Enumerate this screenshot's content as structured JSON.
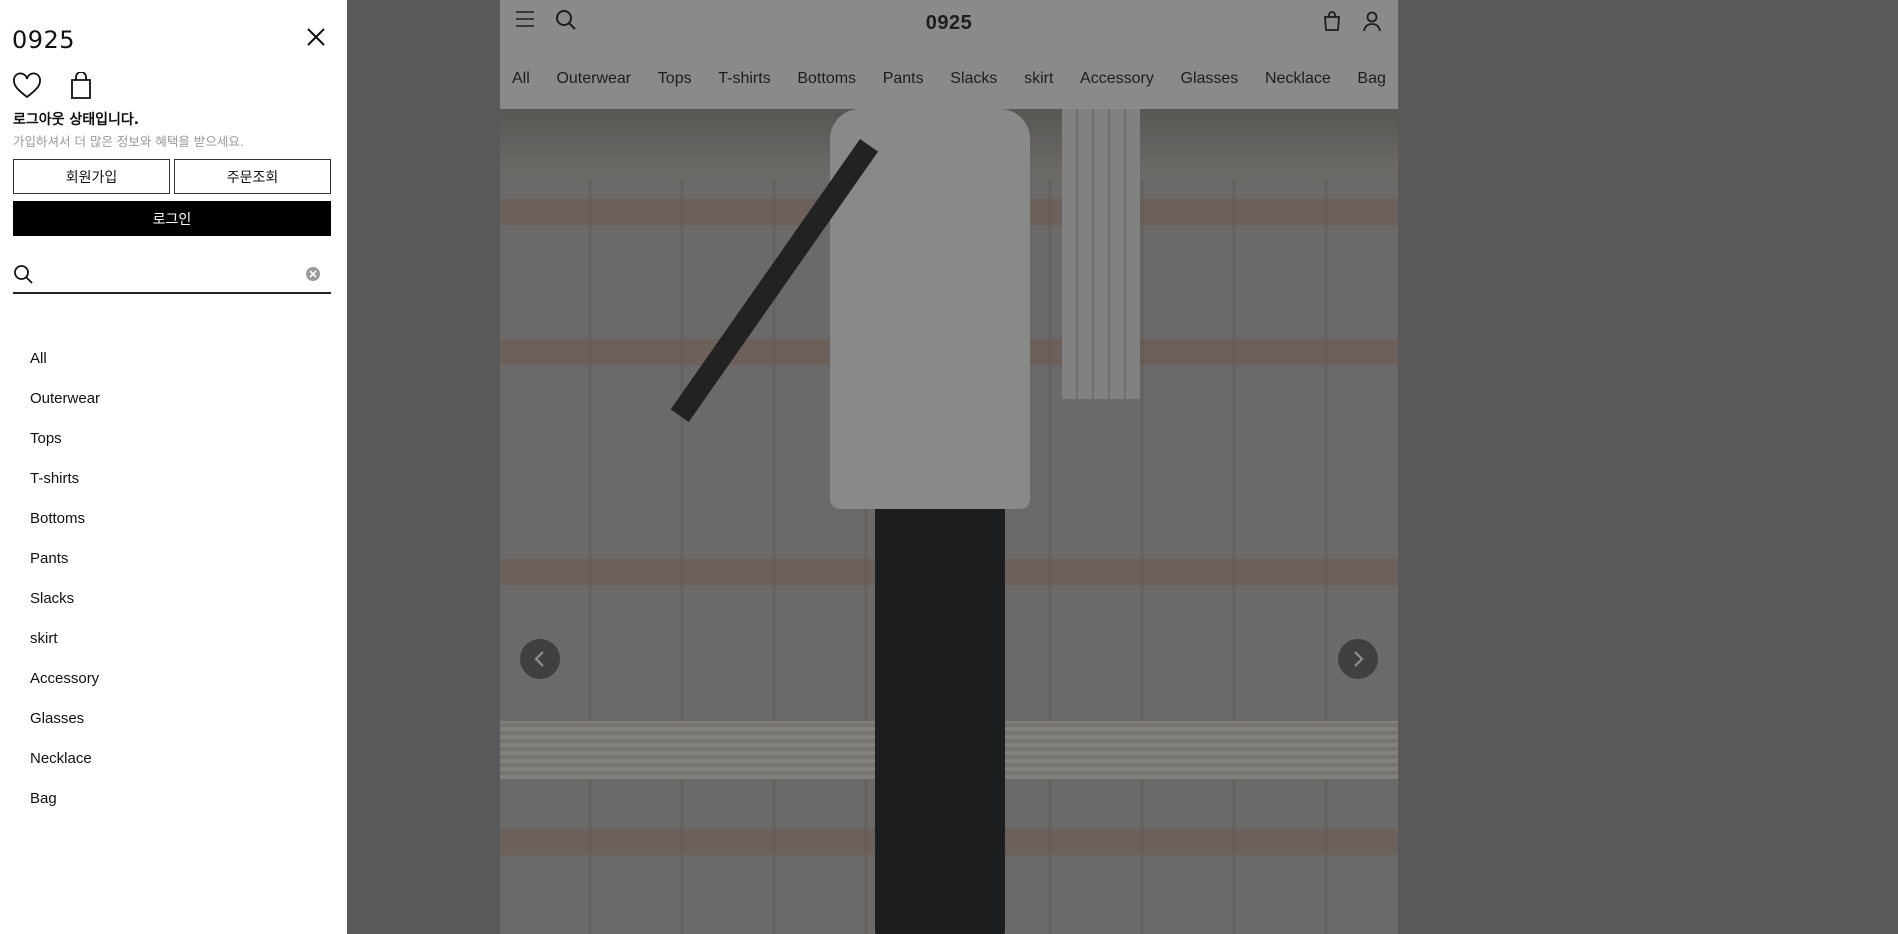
{
  "header": {
    "brand": "0925",
    "icons": [
      "hamburger-menu-icon",
      "search-icon",
      "shopping-bag-icon",
      "user-icon"
    ]
  },
  "categories": [
    "All",
    "Outerwear",
    "Tops",
    "T-shirts",
    "Bottoms",
    "Pants",
    "Slacks",
    "skirt",
    "Accessory",
    "Glasses",
    "Necklace",
    "Bag"
  ],
  "hero": {
    "prev_icon": "chevron-left-icon",
    "next_icon": "chevron-right-icon"
  },
  "drawer": {
    "title": "0925",
    "status": "로그아웃 상태입니다.",
    "status_sub": "가입하셔서 더 많은 정보와 혜택을 받으세요.",
    "signup_label": "회원가입",
    "order_lookup_label": "주문조회",
    "login_label": "로그인",
    "search_value": "",
    "search_placeholder": "",
    "menu": [
      "All",
      "Outerwear",
      "Tops",
      "T-shirts",
      "Bottoms",
      "Pants",
      "Slacks",
      "skirt",
      "Accessory",
      "Glasses",
      "Necklace",
      "Bag"
    ]
  },
  "colors": {
    "overlay": "#282828",
    "login_bg": "#000000",
    "drawer_bg": "#ffffff",
    "muted_text": "#9a9a9a"
  }
}
